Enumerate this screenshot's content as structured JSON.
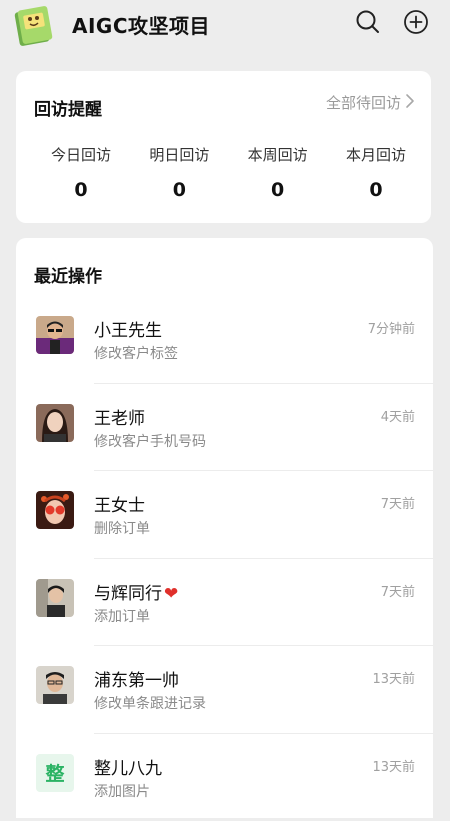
{
  "header": {
    "title": "AIGC攻坚项目",
    "logo_icon": "book-logo-icon",
    "search_icon": "search-icon",
    "add_icon": "add-circle-icon"
  },
  "reminder": {
    "title": "回访提醒",
    "all_link": "全部待回访",
    "stats": [
      {
        "label": "今日回访",
        "value": "0"
      },
      {
        "label": "明日回访",
        "value": "0"
      },
      {
        "label": "本周回访",
        "value": "0"
      },
      {
        "label": "本月回访",
        "value": "0"
      }
    ]
  },
  "recent": {
    "title": "最近操作",
    "items": [
      {
        "name": "小王先生",
        "action": "修改客户标签",
        "time": "7分钟前"
      },
      {
        "name": "王老师",
        "action": "修改客户手机号码",
        "time": "4天前"
      },
      {
        "name": "王女士",
        "action": "删除订单",
        "time": "7天前"
      },
      {
        "name": "与辉同行",
        "action": "添加订单",
        "time": "7天前"
      },
      {
        "name": "浦东第一帅",
        "action": "修改单条跟进记录",
        "time": "13天前"
      },
      {
        "name": "整儿八九",
        "action": "添加图片",
        "time": "13天前",
        "avatar_text": "整"
      }
    ]
  },
  "colors": {
    "background": "#ededed",
    "card": "#ffffff",
    "text_secondary": "#8a8a8a",
    "accent_green": "#2bb364",
    "heart_red": "#e0302b"
  }
}
